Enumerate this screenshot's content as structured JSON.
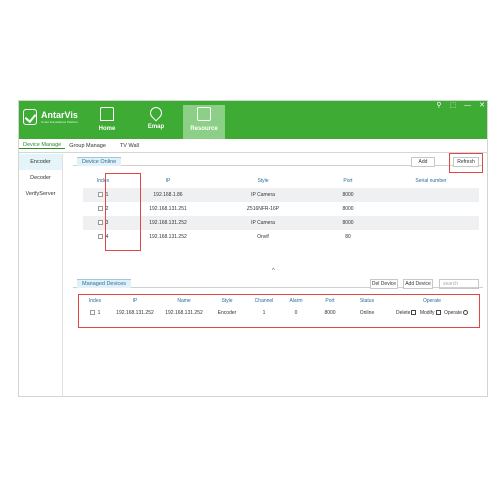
{
  "app": {
    "name": "AntarVis",
    "tagline": "Smart Surveillance Platform"
  },
  "nav": [
    {
      "label": "Home"
    },
    {
      "label": "Emap"
    },
    {
      "label": "Resource"
    }
  ],
  "window_controls": [
    "⚲",
    "⬚",
    "—",
    "✕"
  ],
  "tabs": [
    {
      "label": "Device Manage"
    },
    {
      "label": "Group Manage"
    },
    {
      "label": "TV Wall"
    }
  ],
  "left_nav": [
    {
      "label": "Encoder"
    },
    {
      "label": "Decoder"
    },
    {
      "label": "VerifyServer"
    }
  ],
  "device_online": {
    "title": "Device Online",
    "add_label": "Add",
    "refresh_label": "Refresh",
    "columns": [
      "Index",
      "IP",
      "Style",
      "Port",
      "Serial number"
    ],
    "rows": [
      {
        "index": "1",
        "ip": "192.168.1.86",
        "style": "IP Camera",
        "port": "8000",
        "serial": ""
      },
      {
        "index": "2",
        "ip": "192.168.131.251",
        "style": "Z516NFR-16P",
        "port": "8000",
        "serial": ""
      },
      {
        "index": "3",
        "ip": "192.168.131.252",
        "style": "IP Camera",
        "port": "8000",
        "serial": ""
      },
      {
        "index": "4",
        "ip": "192.168.131.252",
        "style": "Onvif",
        "port": "80",
        "serial": ""
      }
    ]
  },
  "collapse_glyph": "^",
  "managed_devices": {
    "title": "Managed Devices",
    "del_label": "Del Device",
    "add_label": "Add Device",
    "search_placeholder": "search",
    "columns": [
      "Index",
      "IP",
      "Name",
      "Style",
      "Channel",
      "Alarm",
      "Port",
      "Status",
      "Operate"
    ],
    "rows": [
      {
        "index": "1",
        "ip": "192.168.131.252",
        "name": "192.168.131.252",
        "style": "Encoder",
        "channel": "1",
        "alarm": "0",
        "port": "8000",
        "status": "Online",
        "ops": {
          "delete": "Delete",
          "modify": "Modify",
          "operate": "Operate"
        }
      }
    ]
  },
  "colors": {
    "header_green": "#3eab34",
    "highlight_red": "#e34646",
    "title_blue": "#2a6f97"
  }
}
